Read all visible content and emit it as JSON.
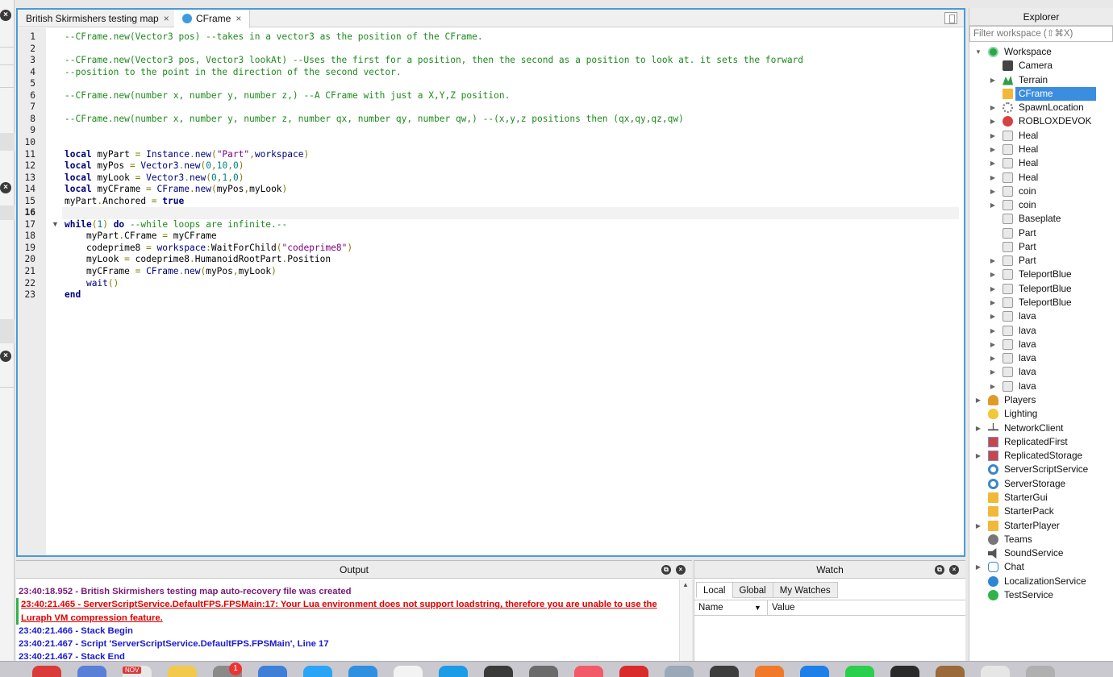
{
  "tabs": [
    {
      "label": "British Skirmishers testing map",
      "close": "×",
      "active": false
    },
    {
      "label": "CFrame",
      "close": "×",
      "active": true
    }
  ],
  "editor": {
    "current_line": 16,
    "lines": [
      {
        "n": "1",
        "html": "<span class='c'>--CFrame.new(Vector3 pos) --takes in a vector3 as the position of the CFrame.</span>"
      },
      {
        "n": "2",
        "html": ""
      },
      {
        "n": "3",
        "html": "<span class='c'>--CFrame.new(Vector3 pos, Vector3 lookAt) --Uses the first for a position, then the second as a position to look at. it sets the forward</span>"
      },
      {
        "n": "4",
        "html": "<span class='c'>--position to the point in the direction of the second vector.</span>"
      },
      {
        "n": "5",
        "html": ""
      },
      {
        "n": "6",
        "html": "<span class='c'>--CFrame.new(number x, number y, number z,) --A CFrame with just a X,Y,Z position.</span>"
      },
      {
        "n": "7",
        "html": ""
      },
      {
        "n": "8",
        "html": "<span class='c'>--CFrame.new(number x, number y, number z, number qx, number qy, number qw,) --(x,y,z positions then (qx,qy,qz,qw)</span>"
      },
      {
        "n": "9",
        "html": ""
      },
      {
        "n": "10",
        "html": ""
      },
      {
        "n": "11",
        "html": "<span class='k'>local</span> myPart <span class='o'>=</span> <span class='b'>Instance</span><span class='o'>.</span><span class='b'>new</span><span class='o'>(</span><span class='s'>\"Part\"</span><span class='o'>,</span><span class='b'>workspace</span><span class='o'>)</span>"
      },
      {
        "n": "12",
        "html": "<span class='k'>local</span> myPos <span class='o'>=</span> <span class='b'>Vector3</span><span class='o'>.</span><span class='b'>new</span><span class='o'>(</span><span class='n'>0</span><span class='o'>,</span><span class='n'>10</span><span class='o'>,</span><span class='n'>0</span><span class='o'>)</span>"
      },
      {
        "n": "13",
        "html": "<span class='k'>local</span> myLook <span class='o'>=</span> <span class='b'>Vector3</span><span class='o'>.</span><span class='b'>new</span><span class='o'>(</span><span class='n'>0</span><span class='o'>,</span><span class='n'>1</span><span class='o'>,</span><span class='n'>0</span><span class='o'>)</span>"
      },
      {
        "n": "14",
        "html": "<span class='k'>local</span> myCFrame <span class='o'>=</span> <span class='b'>CFrame</span><span class='o'>.</span><span class='b'>new</span><span class='o'>(</span>myPos<span class='o'>,</span>myLook<span class='o'>)</span>"
      },
      {
        "n": "15",
        "html": "myPart<span class='o'>.</span>Anchored <span class='o'>=</span> <span class='k'>true</span>"
      },
      {
        "n": "16",
        "html": ""
      },
      {
        "n": "17",
        "html": "<span class='k'>while</span><span class='o'>(</span><span class='n'>1</span><span class='o'>)</span> <span class='k'>do</span> <span class='c'>--while loops are infinite.--</span>"
      },
      {
        "n": "18",
        "html": "    myPart<span class='o'>.</span>CFrame <span class='o'>=</span> myCFrame"
      },
      {
        "n": "19",
        "html": "    codeprime8 <span class='o'>=</span> <span class='b'>workspace</span><span class='o'>:</span>WaitForChild<span class='o'>(</span><span class='s'>\"codeprime8\"</span><span class='o'>)</span>"
      },
      {
        "n": "20",
        "html": "    myLook <span class='o'>=</span> codeprime8<span class='o'>.</span>HumanoidRootPart<span class='o'>.</span>Position"
      },
      {
        "n": "21",
        "html": "    myCFrame <span class='o'>=</span> <span class='b'>CFrame</span><span class='o'>.</span><span class='b'>new</span><span class='o'>(</span>myPos<span class='o'>,</span>myLook<span class='o'>)</span>"
      },
      {
        "n": "22",
        "html": "    <span class='b'>wait</span><span class='o'>()</span>"
      },
      {
        "n": "23",
        "html": "<span class='k'>end</span>"
      }
    ]
  },
  "output": {
    "title": "Output",
    "lines": [
      {
        "text": "23:40:18.952 - British Skirmishers testing map auto-recovery file was created",
        "kind": "purple"
      },
      {
        "text": "23:40:21.465 - ServerScriptService.DefaultFPS.FPSMain:17: Your Lua environment does not support loadstring, therefore you are unable to use the Luraph VM compression feature.",
        "kind": "red"
      },
      {
        "text": "23:40:21.466 - Stack Begin",
        "kind": "blue"
      },
      {
        "text": "23:40:21.467 - Script 'ServerScriptService.DefaultFPS.FPSMain', Line 17",
        "kind": "blue"
      },
      {
        "text": "23:40:21.467 - Stack End",
        "kind": "blue"
      }
    ]
  },
  "watch": {
    "title": "Watch",
    "tabs": [
      "Local",
      "Global",
      "My Watches"
    ],
    "col_name": "Name",
    "col_value": "Value"
  },
  "explorer": {
    "title": "Explorer",
    "filter_placeholder": "Filter workspace (⇧⌘X)",
    "items": [
      {
        "label": "Workspace",
        "depth": 0,
        "arrow": "▼",
        "icon": "globe",
        "icon_name": "workspace-icon"
      },
      {
        "label": "Camera",
        "depth": 1,
        "arrow": "",
        "icon": "cam",
        "icon_name": "camera-icon"
      },
      {
        "label": "Terrain",
        "depth": 1,
        "arrow": "▶",
        "icon": "terrain",
        "icon_name": "terrain-icon"
      },
      {
        "label": "CFrame",
        "depth": 1,
        "arrow": "",
        "icon": "folder",
        "icon_name": "script-icon",
        "selected": true
      },
      {
        "label": "SpawnLocation",
        "depth": 1,
        "arrow": "▶",
        "icon": "spawn",
        "icon_name": "spawn-location-icon"
      },
      {
        "label": "ROBLOXDEVOK",
        "depth": 1,
        "arrow": "▶",
        "icon": "fig",
        "icon_name": "character-icon"
      },
      {
        "label": "Heal",
        "depth": 1,
        "arrow": "▶",
        "icon": "part",
        "icon_name": "part-icon"
      },
      {
        "label": "Heal",
        "depth": 1,
        "arrow": "▶",
        "icon": "part",
        "icon_name": "part-icon"
      },
      {
        "label": "Heal",
        "depth": 1,
        "arrow": "▶",
        "icon": "part",
        "icon_name": "part-icon"
      },
      {
        "label": "Heal",
        "depth": 1,
        "arrow": "▶",
        "icon": "part",
        "icon_name": "part-icon"
      },
      {
        "label": "coin",
        "depth": 1,
        "arrow": "▶",
        "icon": "part",
        "icon_name": "part-icon"
      },
      {
        "label": "coin",
        "depth": 1,
        "arrow": "▶",
        "icon": "part",
        "icon_name": "part-icon"
      },
      {
        "label": "Baseplate",
        "depth": 1,
        "arrow": "",
        "icon": "part",
        "icon_name": "part-icon"
      },
      {
        "label": "Part",
        "depth": 1,
        "arrow": "",
        "icon": "part",
        "icon_name": "part-icon"
      },
      {
        "label": "Part",
        "depth": 1,
        "arrow": "",
        "icon": "part",
        "icon_name": "part-icon"
      },
      {
        "label": "Part",
        "depth": 1,
        "arrow": "▶",
        "icon": "part",
        "icon_name": "part-icon"
      },
      {
        "label": "TeleportBlue",
        "depth": 1,
        "arrow": "▶",
        "icon": "part",
        "icon_name": "part-icon"
      },
      {
        "label": "TeleportBlue",
        "depth": 1,
        "arrow": "▶",
        "icon": "part",
        "icon_name": "part-icon"
      },
      {
        "label": "TeleportBlue",
        "depth": 1,
        "arrow": "▶",
        "icon": "part",
        "icon_name": "part-icon"
      },
      {
        "label": "lava",
        "depth": 1,
        "arrow": "▶",
        "icon": "part",
        "icon_name": "part-icon"
      },
      {
        "label": "lava",
        "depth": 1,
        "arrow": "▶",
        "icon": "part",
        "icon_name": "part-icon"
      },
      {
        "label": "lava",
        "depth": 1,
        "arrow": "▶",
        "icon": "part",
        "icon_name": "part-icon"
      },
      {
        "label": "lava",
        "depth": 1,
        "arrow": "▶",
        "icon": "part",
        "icon_name": "part-icon"
      },
      {
        "label": "lava",
        "depth": 1,
        "arrow": "▶",
        "icon": "part",
        "icon_name": "part-icon"
      },
      {
        "label": "lava",
        "depth": 1,
        "arrow": "▶",
        "icon": "part",
        "icon_name": "part-icon"
      },
      {
        "label": "Players",
        "depth": 0,
        "arrow": "▶",
        "icon": "players",
        "icon_name": "players-icon"
      },
      {
        "label": "Lighting",
        "depth": 0,
        "arrow": "",
        "icon": "bulb",
        "icon_name": "lighting-icon"
      },
      {
        "label": "NetworkClient",
        "depth": 0,
        "arrow": "▶",
        "icon": "net",
        "icon_name": "network-icon"
      },
      {
        "label": "ReplicatedFirst",
        "depth": 0,
        "arrow": "",
        "icon": "rep",
        "icon_name": "replicated-first-icon"
      },
      {
        "label": "ReplicatedStorage",
        "depth": 0,
        "arrow": "▶",
        "icon": "rep",
        "icon_name": "replicated-storage-icon"
      },
      {
        "label": "ServerScriptService",
        "depth": 0,
        "arrow": "",
        "icon": "gear",
        "icon_name": "server-script-service-icon"
      },
      {
        "label": "ServerStorage",
        "depth": 0,
        "arrow": "",
        "icon": "gear",
        "icon_name": "server-storage-icon"
      },
      {
        "label": "StarterGui",
        "depth": 0,
        "arrow": "",
        "icon": "folder",
        "icon_name": "starter-gui-icon"
      },
      {
        "label": "StarterPack",
        "depth": 0,
        "arrow": "",
        "icon": "folder",
        "icon_name": "starter-pack-icon"
      },
      {
        "label": "StarterPlayer",
        "depth": 0,
        "arrow": "▶",
        "icon": "folder",
        "icon_name": "starter-player-icon"
      },
      {
        "label": "Teams",
        "depth": 0,
        "arrow": "",
        "icon": "team",
        "icon_name": "teams-icon"
      },
      {
        "label": "SoundService",
        "depth": 0,
        "arrow": "",
        "icon": "sound",
        "icon_name": "sound-service-icon"
      },
      {
        "label": "Chat",
        "depth": 0,
        "arrow": "▶",
        "icon": "chat",
        "icon_name": "chat-icon"
      },
      {
        "label": "LocalizationService",
        "depth": 0,
        "arrow": "",
        "icon": "loc",
        "icon_name": "localization-icon"
      },
      {
        "label": "TestService",
        "depth": 0,
        "arrow": "",
        "icon": "test",
        "icon_name": "test-service-icon"
      }
    ]
  },
  "dock": {
    "badge": "1",
    "calendar_month": "NOV",
    "apps": [
      {
        "color": "#d93a3a"
      },
      {
        "color": "#5a7fd6"
      },
      {
        "color": "#e8e8e8"
      },
      {
        "color": "#f2c94c"
      },
      {
        "color": "#8a8a8a"
      },
      {
        "color": "#3f7fd8"
      },
      {
        "color": "#2aa4f4"
      },
      {
        "color": "#2f8fe0"
      },
      {
        "color": "#f3f3f3"
      },
      {
        "color": "#1c9be6"
      },
      {
        "color": "#3a3a3a"
      },
      {
        "color": "#6b6b6b"
      },
      {
        "color": "#f25a6a"
      },
      {
        "color": "#d92b2b"
      },
      {
        "color": "#9aa8b8"
      },
      {
        "color": "#3d3d3d"
      },
      {
        "color": "#f07a2a"
      },
      {
        "color": "#1e7fe8"
      },
      {
        "color": "#2bcf4e"
      },
      {
        "color": "#2a2a2a"
      },
      {
        "color": "#9a6a3a"
      },
      {
        "color": "#e6e6e6"
      },
      {
        "color": "#b0b0b0"
      }
    ]
  }
}
